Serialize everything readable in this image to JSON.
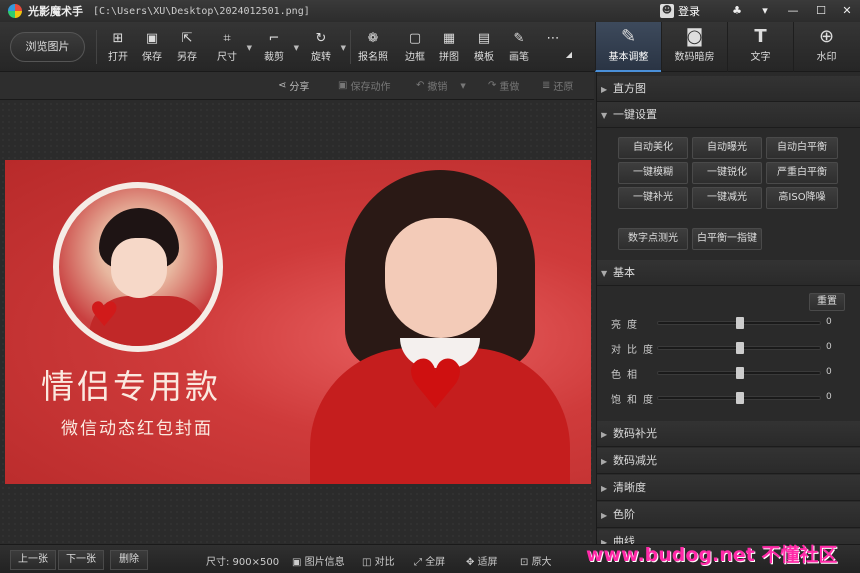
{
  "app": {
    "title": "光影魔术手",
    "file_path": "[C:\\Users\\XU\\Desktop\\2024012501.png]",
    "login_label": "登录"
  },
  "toolbar": {
    "browse_label": "浏览图片",
    "tools": [
      {
        "label": "打开",
        "icon": "open-icon"
      },
      {
        "label": "保存",
        "icon": "save-icon"
      },
      {
        "label": "另存",
        "icon": "save-as-icon"
      },
      {
        "label": "尺寸",
        "icon": "resize-icon"
      },
      {
        "label": "裁剪",
        "icon": "crop-icon"
      },
      {
        "label": "旋转",
        "icon": "rotate-icon"
      },
      {
        "label": "报名照",
        "icon": "id-photo-icon"
      },
      {
        "label": "边框",
        "icon": "border-icon"
      },
      {
        "label": "拼图",
        "icon": "collage-icon"
      },
      {
        "label": "模板",
        "icon": "template-icon"
      },
      {
        "label": "画笔",
        "icon": "brush-icon"
      }
    ],
    "panel_tabs": [
      {
        "label": "基本调整",
        "icon": "adjust-icon",
        "active": true
      },
      {
        "label": "数码暗房",
        "icon": "camera-icon",
        "active": false
      },
      {
        "label": "文字",
        "icon": "text-icon",
        "active": false
      },
      {
        "label": "水印",
        "icon": "watermark-icon",
        "active": false
      }
    ]
  },
  "subbar": {
    "share": "分享",
    "save_action": "保存动作",
    "undo": "撤销",
    "redo": "重做",
    "restore": "还原"
  },
  "image": {
    "headline": "情侣专用款",
    "subline": "微信动态红包封面"
  },
  "panel": {
    "histogram": "直方图",
    "one_click": "一键设置",
    "one_click_buttons": [
      "自动美化",
      "自动曝光",
      "自动白平衡",
      "一键模糊",
      "一键锐化",
      "严重白平衡",
      "一键补光",
      "一键减光",
      "高ISO降噪",
      "数字点测光",
      "白平衡一指键"
    ],
    "basic": "基本",
    "reset": "重置",
    "sliders": [
      {
        "label": "亮度",
        "value": "0",
        "position": 0.5
      },
      {
        "label": "对比度",
        "value": "0",
        "position": 0.5
      },
      {
        "label": "色相",
        "value": "0",
        "position": 0.5
      },
      {
        "label": "饱和度",
        "value": "0",
        "position": 0.5
      }
    ],
    "sections": [
      "数码补光",
      "数码减光",
      "清晰度",
      "色阶",
      "曲线"
    ]
  },
  "statusbar": {
    "prev": "上一张",
    "next": "下一张",
    "delete": "删除",
    "size_label": "尺寸: 900×500",
    "info": "图片信息",
    "compare": "对比",
    "fullscreen": "全屏",
    "fit": "适屏",
    "original": "原大"
  },
  "watermark": "www.budog.net 不懂社区"
}
